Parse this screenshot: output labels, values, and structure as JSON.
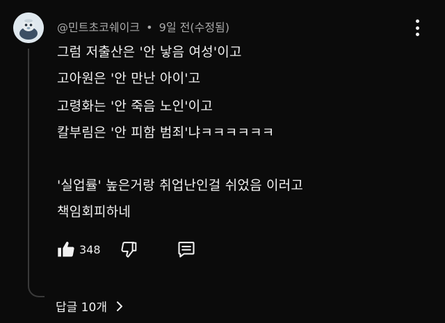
{
  "comment": {
    "author": "@민트초코쉐이크",
    "separator": "•",
    "time": "9일 전(수정됨)",
    "lines": [
      "그럼 저출산은 '안 낳음 여성'이고",
      "고아원은 '안 만난 아이'고",
      "고령화는 '안 죽음 노인'이고",
      "칼부림은 '안 피함 범죄'냐ㅋㅋㅋㅋㅋㅋ",
      "",
      "'실업률' 높은거랑 취업난인걸 쉬었음 이러고",
      "책임회피하네"
    ],
    "like_count": "348",
    "replies_label": "답글 10개"
  },
  "icons": {
    "more": "more-vert-icon",
    "like": "thumbs-up-icon",
    "dislike": "thumbs-down-icon",
    "reply": "comment-icon",
    "expand": "chevron-right-icon"
  },
  "colors": {
    "background": "#0b0b0b",
    "text_primary": "#f1f1f1",
    "text_secondary": "#aaaaaa",
    "thread_line": "#3a3a3a"
  }
}
